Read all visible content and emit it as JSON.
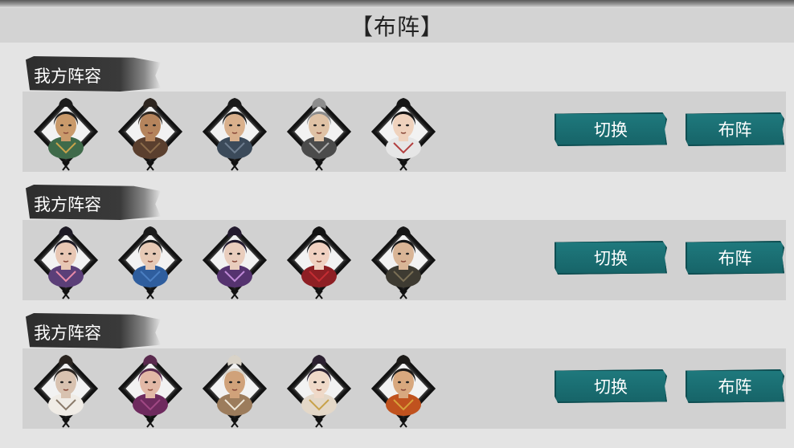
{
  "title": "【布阵】",
  "formations": [
    {
      "label": "我方阵容",
      "switch_label": "切换",
      "deploy_label": "布阵",
      "heroes": [
        {
          "icon": "hero-portrait-icon",
          "hair": "#1c1c1c",
          "skin": "#c99a6b",
          "robe": "#3f6a4a",
          "accent": "#c8a34a"
        },
        {
          "icon": "hero-portrait-icon",
          "hair": "#2e2620",
          "skin": "#b5845c",
          "robe": "#5a3f2e",
          "accent": "#8a6b4a"
        },
        {
          "icon": "hero-portrait-icon",
          "hair": "#1a1a1a",
          "skin": "#d9b08c",
          "robe": "#3b4a5a",
          "accent": "#6d7d8f"
        },
        {
          "icon": "hero-portrait-icon",
          "hair": "#8d8d8d",
          "skin": "#dfc2a5",
          "robe": "#4b4b4b",
          "accent": "#a9a9a9"
        },
        {
          "icon": "hero-portrait-icon",
          "hair": "#151515",
          "skin": "#efd2bd",
          "robe": "#e6e6e6",
          "accent": "#b34040"
        }
      ]
    },
    {
      "label": "我方阵容",
      "switch_label": "切换",
      "deploy_label": "布阵",
      "heroes": [
        {
          "icon": "hero-portrait-icon",
          "hair": "#1d1a24",
          "skin": "#e8c7b4",
          "robe": "#5b3f78",
          "accent": "#e88aa8"
        },
        {
          "icon": "hero-portrait-icon",
          "hair": "#1b1b1b",
          "skin": "#e6c9b5",
          "robe": "#2f5e9e",
          "accent": "#4b7fc2"
        },
        {
          "icon": "hero-portrait-icon",
          "hair": "#231a2e",
          "skin": "#e9cdbd",
          "robe": "#55336f",
          "accent": "#c08ad8"
        },
        {
          "icon": "hero-portrait-icon",
          "hair": "#121212",
          "skin": "#f0d1c1",
          "robe": "#8e1f24",
          "accent": "#c42d33"
        },
        {
          "icon": "hero-portrait-icon",
          "hair": "#161616",
          "skin": "#d9b596",
          "robe": "#3e3b32",
          "accent": "#7a6f55"
        }
      ]
    },
    {
      "label": "我方阵容",
      "switch_label": "切换",
      "deploy_label": "布阵",
      "heroes": [
        {
          "icon": "hero-portrait-icon",
          "hair": "#2a2420",
          "skin": "#d8c2b0",
          "robe": "#f0ece6",
          "accent": "#8a7a6a"
        },
        {
          "icon": "hero-portrait-icon",
          "hair": "#5a2a4e",
          "skin": "#e2b8a6",
          "robe": "#6e2a5e",
          "accent": "#a04884"
        },
        {
          "icon": "hero-portrait-icon",
          "hair": "#d9d3c8",
          "skin": "#d0a27a",
          "robe": "#9c7c5c",
          "accent": "#efe7d8"
        },
        {
          "icon": "hero-portrait-icon",
          "hair": "#2b2030",
          "skin": "#efd9c8",
          "robe": "#e4d8c8",
          "accent": "#c8a24a"
        },
        {
          "icon": "hero-portrait-icon",
          "hair": "#1c1a18",
          "skin": "#d8a87e",
          "robe": "#c0521e",
          "accent": "#d7a13a"
        }
      ]
    }
  ]
}
